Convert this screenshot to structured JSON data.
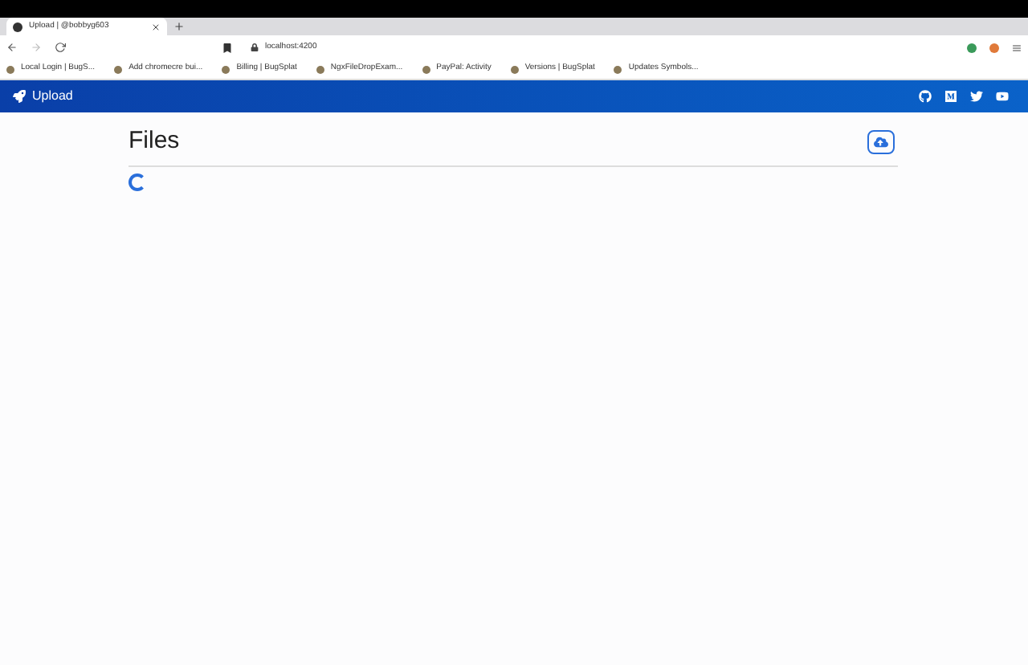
{
  "browser": {
    "tab": {
      "title": "Upload | @bobbyg603"
    },
    "address": "localhost:4200",
    "bookmarks": [
      "Local Login | BugS...",
      "Add chromecre bui...",
      "Billing | BugSplat",
      "NgxFileDropExam...",
      "PayPal: Activity",
      "Versions | BugSplat",
      "Updates Symbols..."
    ]
  },
  "navbar": {
    "brand": "Upload"
  },
  "page": {
    "title": "Files",
    "loading": true
  }
}
